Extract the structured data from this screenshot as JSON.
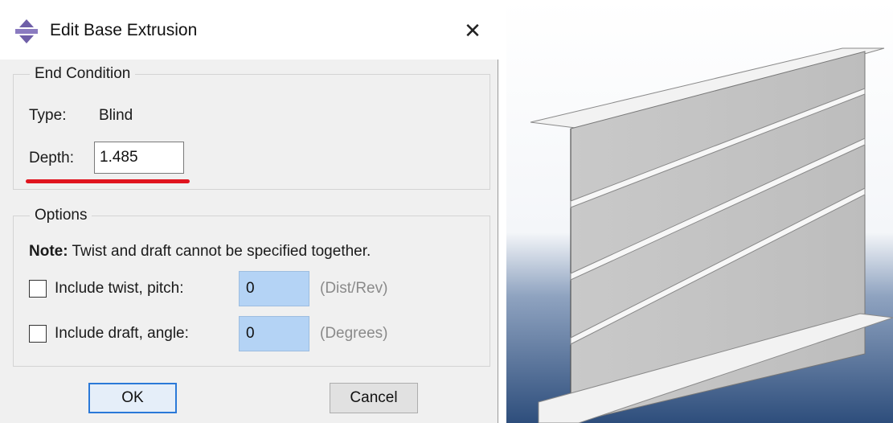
{
  "dialog": {
    "title": "Edit Base Extrusion",
    "close_glyph": "✕",
    "end_condition": {
      "legend": "End Condition",
      "type_label": "Type:",
      "type_value": "Blind",
      "depth_label": "Depth:",
      "depth_value": "1.485"
    },
    "options": {
      "legend": "Options",
      "note_bold": "Note:",
      "note_text": "Twist and draft cannot be specified together.",
      "twist": {
        "label": "Include twist, pitch:",
        "value": "0",
        "unit": "(Dist/Rev)",
        "checked": false
      },
      "draft": {
        "label": "Include draft, angle:",
        "value": "0",
        "unit": "(Degrees)",
        "checked": false
      }
    },
    "buttons": {
      "ok": "OK",
      "cancel": "Cancel"
    }
  },
  "colors": {
    "highlight_underline": "#e0141e",
    "input_highlight": "#b4d3f5",
    "viewport_background_top": "#ffffff",
    "viewport_background_bottom": "#2e4e7c",
    "model_surface": "#c4c4c4"
  },
  "viewport": {
    "description_icon": "extruded-i-beam-with-stiffeners-model"
  }
}
